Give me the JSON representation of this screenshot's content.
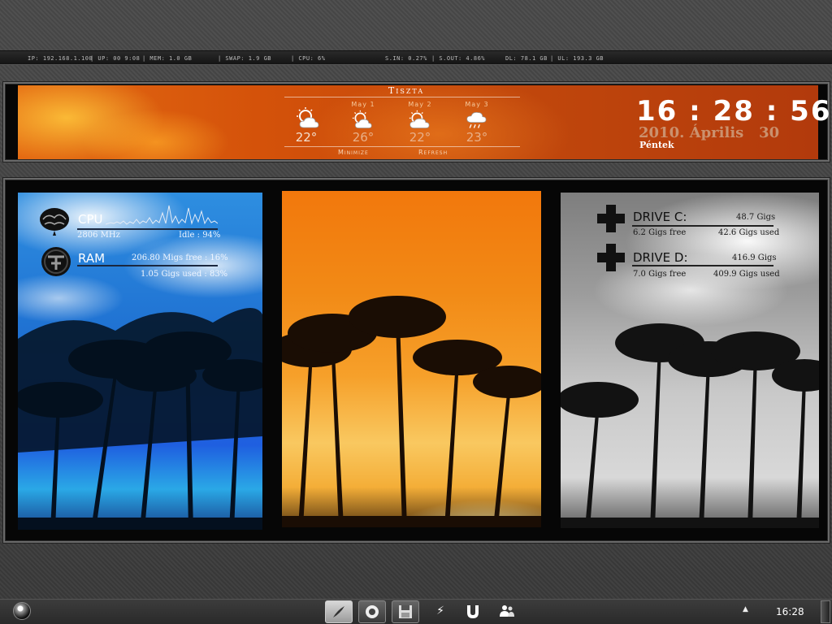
{
  "statbar": {
    "ip": "IP: 192.168.1.100",
    "uptime": "| UP: 00 9:08",
    "mem": "| MEM: 1.0 GB",
    "swap": "| SWAP: 1.9 GB",
    "cpu": "| CPU: 6%",
    "s_in": "S.IN: 0.27%",
    "s_out": "| S.OUT: 4.86%",
    "dl": "DL: 78.1 GB",
    "ul": "| UL: 193.3 GB"
  },
  "weather": {
    "condition": "Tiszta",
    "days": [
      {
        "label": "",
        "temp": "22°",
        "icon": "partly-cloudy-sun-icon"
      },
      {
        "label": "May 1",
        "temp": "26°",
        "icon": "partly-cloudy-sun-icon"
      },
      {
        "label": "May 2",
        "temp": "22°",
        "icon": "partly-cloudy-sun-icon"
      },
      {
        "label": "May 3",
        "temp": "23°",
        "icon": "rain-cloud-icon"
      }
    ],
    "minimize_label": "Minimize",
    "refresh_label": "Refresh"
  },
  "clock": {
    "time": "16 : 28 : 56",
    "date": "2010. Április   30",
    "weekday": "Péntek"
  },
  "system": {
    "cpu": {
      "title": "CPU",
      "freq": "2806 MHz",
      "idle": "Idle : 94%"
    },
    "ram": {
      "title": "RAM",
      "free": "206.80 Migs free : 16%",
      "used": "1.05 Gigs used : 83%"
    }
  },
  "drives": [
    {
      "title": "DRIVE C:",
      "total": "48.7 Gigs",
      "free": "6.2 Gigs free",
      "used": "42.6 Gigs used"
    },
    {
      "title": "DRIVE D:",
      "total": "416.9 Gigs",
      "free": "7.0 Gigs free",
      "used": "409.9 Gigs used"
    }
  ],
  "taskbar": {
    "pinned": [
      "feather-app-icon",
      "media-player-icon",
      "floppy-save-icon"
    ],
    "tray": [
      "lightning-icon",
      "utorrent-icon",
      "users-icon"
    ],
    "time": "16:28"
  },
  "colors": {
    "banner_orange": "#d4520a",
    "frame_border": "#6a6a6a",
    "taskbar_bg": "#2a2a2a"
  }
}
